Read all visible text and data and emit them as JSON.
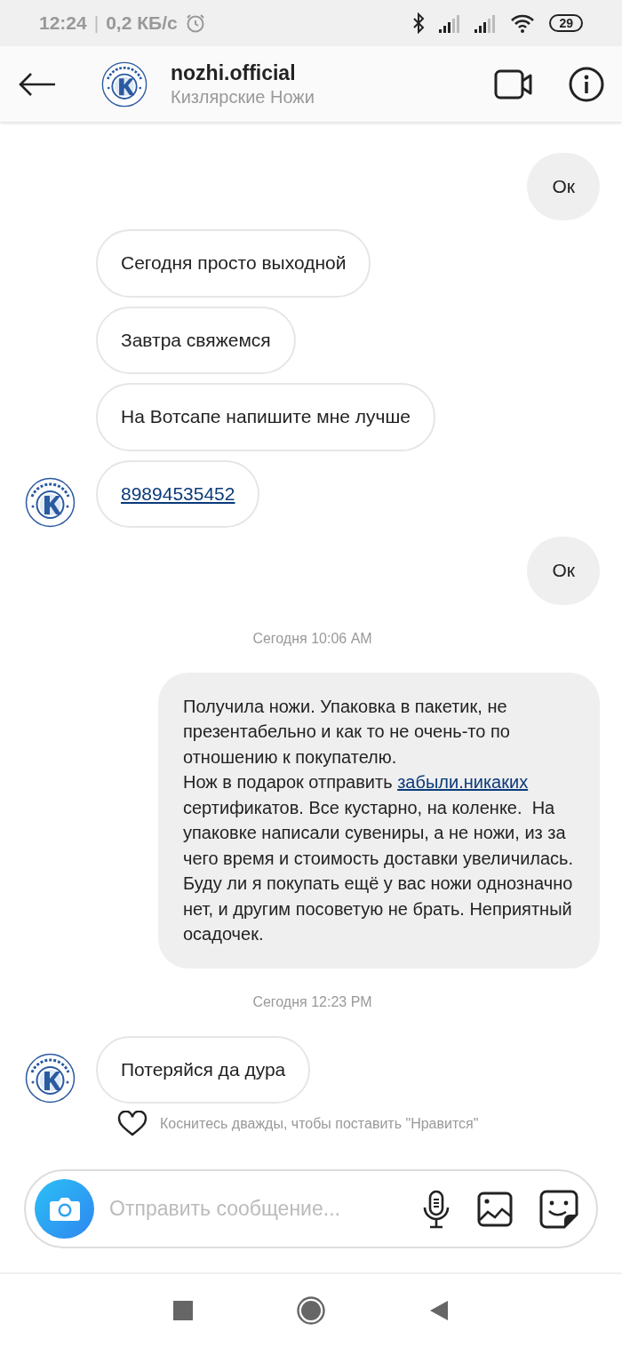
{
  "status_bar": {
    "time": "12:24",
    "separator": "|",
    "speed": "0,2 КБ/с",
    "battery": "29"
  },
  "header": {
    "username": "nozhi.official",
    "full_name": "Кизлярские Ножи"
  },
  "messages": [
    {
      "kind": "message",
      "outgoing": true,
      "avatar": false,
      "parts": [
        {
          "text": "Ок",
          "link": false
        }
      ]
    },
    {
      "kind": "message",
      "outgoing": false,
      "avatar": false,
      "parts": [
        {
          "text": "Сегодня просто выходной",
          "link": false
        }
      ]
    },
    {
      "kind": "message",
      "outgoing": false,
      "avatar": false,
      "parts": [
        {
          "text": "Завтра свяжемся",
          "link": false
        }
      ]
    },
    {
      "kind": "message",
      "outgoing": false,
      "avatar": false,
      "parts": [
        {
          "text": "На Вотсапе напишите мне лучше",
          "link": false
        }
      ]
    },
    {
      "kind": "message",
      "outgoing": false,
      "avatar": true,
      "parts": [
        {
          "text": "89894535452",
          "link": true
        }
      ]
    },
    {
      "kind": "message",
      "outgoing": true,
      "avatar": false,
      "parts": [
        {
          "text": "Ок",
          "link": false
        }
      ]
    },
    {
      "kind": "time",
      "text": "Сегодня 10:06 AM"
    },
    {
      "kind": "message",
      "outgoing": true,
      "avatar": false,
      "parts": [
        {
          "text": "Получила ножи. Упаковка в пакетик, не презентабельно и как то не очень-то по отношению к покупателю.\nНож в подарок отправить ",
          "link": false
        },
        {
          "text": "забыли.никаких",
          "link": true
        },
        {
          "text": " сертификатов. Все кустарно, на коленке.  На упаковке написали сувениры, а не ножи, из за чего время и стоимость доставки увеличилась. Буду ли я покупать ещё у вас ножи однозначно нет, и другим посоветую не брать. Неприятный осадочек.",
          "link": false
        }
      ]
    },
    {
      "kind": "time",
      "text": "Сегодня 12:23 PM"
    },
    {
      "kind": "message",
      "outgoing": false,
      "avatar": true,
      "parts": [
        {
          "text": "Потеряйся да дура",
          "link": false
        }
      ]
    }
  ],
  "like_hint": {
    "text": "Коснитесь дважды, чтобы поставить \"Нравится\""
  },
  "composer": {
    "placeholder": "Отправить сообщение..."
  }
}
